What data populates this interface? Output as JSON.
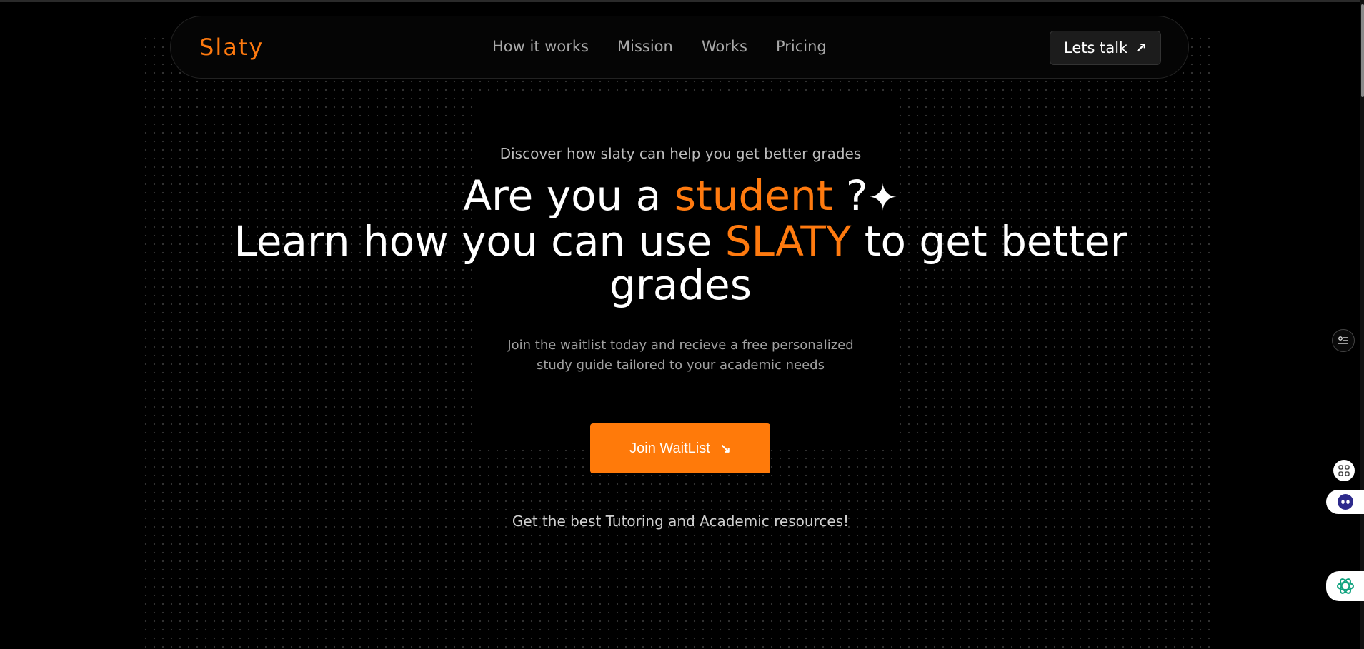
{
  "brand": {
    "name": "Slaty",
    "accent_color": "#ff7a0f"
  },
  "nav": {
    "links": [
      "How it works",
      "Mission",
      "Works",
      "Pricing"
    ],
    "cta_label": "Lets talk",
    "cta_icon": "arrow-up-right-icon"
  },
  "hero": {
    "subtitle": "Discover how slaty can help you get better grades",
    "headline_part1": "Are you a ",
    "headline_accent1": "student",
    "headline_part2": " ?",
    "headline_icon": "sparkle-icon",
    "headline_part3": "Learn how you can use ",
    "headline_accent2": "SLATY",
    "headline_part4": " to get better grades",
    "description": "Join the waitlist today and recieve a free personalized study guide tailored to your academic needs",
    "button_label": "Join WaitList",
    "button_icon": "arrow-down-right-icon",
    "tagline": "Get the best Tutoring and Academic resources!"
  },
  "sidebar_widgets": [
    "filter-settings-icon",
    "grid-apps-icon",
    "bot-face-icon",
    "openai-logo-icon"
  ]
}
